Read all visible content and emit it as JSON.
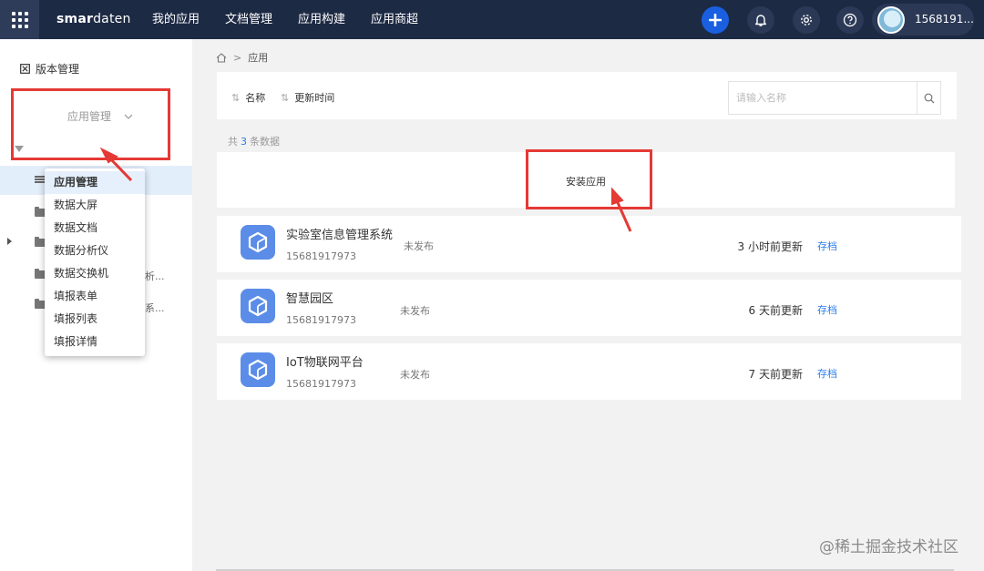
{
  "topbar": {
    "logo_bold": "smar",
    "logo_rest": "daten",
    "nav": [
      "我的应用",
      "文档管理",
      "应用构建",
      "应用商超"
    ],
    "user_name": "1568191...",
    "colors": {
      "bar": "#1d2a44",
      "accent": "#1a5fe0"
    }
  },
  "sidebar": {
    "version_label": "版本管理",
    "select_value": "应用管理",
    "dropdown_options": [
      "应用管理",
      "数据大屏",
      "数据文档",
      "数据分析仪",
      "数据交换机",
      "填报表单",
      "填报列表",
      "填报详情"
    ],
    "truncated_1": "析...",
    "truncated_2": "系..."
  },
  "breadcrumb": {
    "current": "应用"
  },
  "toolbar": {
    "sort_name": "名称",
    "sort_updated": "更新时间",
    "search_placeholder": "请输入名称"
  },
  "count": {
    "prefix": "共",
    "number": "3",
    "suffix": "条数据"
  },
  "install_label": "安装应用",
  "apps": [
    {
      "name": "实验室信息管理系统",
      "owner": "15681917973",
      "status": "未发布",
      "updated": "3 小时前更新",
      "archive": "存档"
    },
    {
      "name": "智慧园区",
      "owner": "15681917973",
      "status": "未发布",
      "updated": "6 天前更新",
      "archive": "存档"
    },
    {
      "name": "IoT物联网平台",
      "owner": "15681917973",
      "status": "未发布",
      "updated": "7 天前更新",
      "archive": "存档"
    }
  ],
  "watermark": "@稀土掘金技术社区",
  "annotation_color": "#e53935"
}
